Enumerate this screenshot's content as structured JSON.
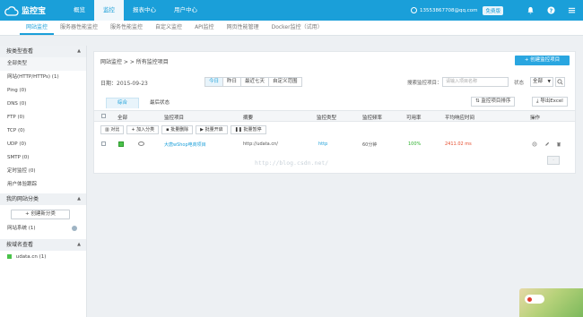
{
  "app": {
    "logo_text": "监控宝"
  },
  "topnav": [
    {
      "label": "概览"
    },
    {
      "label": "监控"
    },
    {
      "label": "报表中心"
    },
    {
      "label": "用户中心"
    }
  ],
  "user": {
    "email": "13553867708@qq.com",
    "plan": "免费版"
  },
  "subnav": [
    {
      "label": "网站监控"
    },
    {
      "label": "服务器性能监控"
    },
    {
      "label": "服务性能监控"
    },
    {
      "label": "自定义监控"
    },
    {
      "label": "API监控"
    },
    {
      "label": "网页性能管理"
    },
    {
      "label": "Docker监控（试用）"
    }
  ],
  "sidebar": {
    "by_type_header": "按类型查看",
    "type_items": [
      {
        "label": "全部类型"
      },
      {
        "label": "网站(HTTP/HTTPs) (1)"
      },
      {
        "label": "Ping (0)"
      },
      {
        "label": "DNS (0)"
      },
      {
        "label": "FTP (0)"
      },
      {
        "label": "TCP (0)"
      },
      {
        "label": "UDP (0)"
      },
      {
        "label": "SMTP (0)"
      },
      {
        "label": "定时监控 (0)"
      },
      {
        "label": "用户体验跟踪"
      }
    ],
    "my_groups_header": "我的网站分类",
    "new_group_label": "+ 创建新分类",
    "group_items": [
      {
        "label": "网站系统 (1)"
      }
    ],
    "by_domain_header": "按域名查看",
    "domain_items": [
      {
        "label": "udata.cn (1)"
      }
    ]
  },
  "main": {
    "breadcrumb": "网站监控 > > 所有监控项目",
    "create_button": "+ 创建监控项目",
    "date_label": "日期：2015-09-23",
    "date_ranges": [
      "今日",
      "昨日",
      "最近七天",
      "自定义范围"
    ],
    "search_label": "搜索监控项目：",
    "search_placeholder": "请输入项目名称",
    "status_label": "状态",
    "status_value": "全部",
    "tabs": [
      "综合",
      "最后状态"
    ],
    "sort_button": "监控项目排序",
    "export_button": "导出Excel",
    "columns": [
      "全部",
      "监控项目",
      "摘要",
      "监控类型",
      "监控频率",
      "可用率",
      "平均响应时间",
      "操作"
    ],
    "actions": [
      "对比",
      "+ 加入分类",
      "批量删除",
      "批量开启",
      "批量暂停"
    ],
    "rows": [
      {
        "name": "大唐wShop电商项目",
        "summary": "http://udata.cn/",
        "type": "http",
        "frequency": "60分钟",
        "availability": "100%",
        "avg_response": "2411.02 ms"
      }
    ],
    "watermark": "http://blog.csdn.net/"
  },
  "colors": {
    "primary": "#1a9fd9",
    "ok": "#2fb12f",
    "warn": "#e54d2e"
  }
}
